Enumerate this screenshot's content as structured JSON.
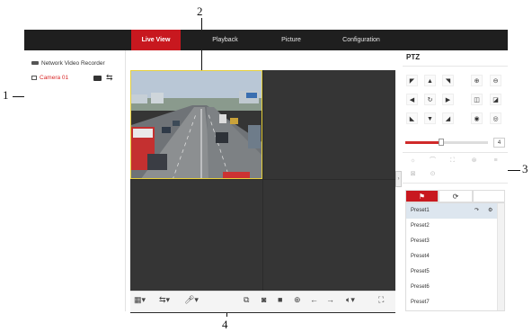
{
  "callouts": [
    "1",
    "2",
    "3",
    "4"
  ],
  "nav": {
    "tabs": [
      {
        "label": "Live View",
        "active": true
      },
      {
        "label": "Playback",
        "active": false
      },
      {
        "label": "Picture",
        "active": false
      },
      {
        "label": "Configuration",
        "active": false
      }
    ]
  },
  "left_panel": {
    "device": "Network Video Recorder",
    "camera": "Camera 01"
  },
  "ptz": {
    "title": "PTZ",
    "speed": "4",
    "speed_fraction": 0.43,
    "presets": [
      "Preset1",
      "Preset2",
      "Preset3",
      "Preset4",
      "Preset5",
      "Preset6",
      "Preset7"
    ]
  },
  "colors": {
    "accent": "#c8181f",
    "nav_bg": "#1f1f1f",
    "grid_bg": "#2b2b2b",
    "selected_cell_border": "#e6cf3a"
  }
}
